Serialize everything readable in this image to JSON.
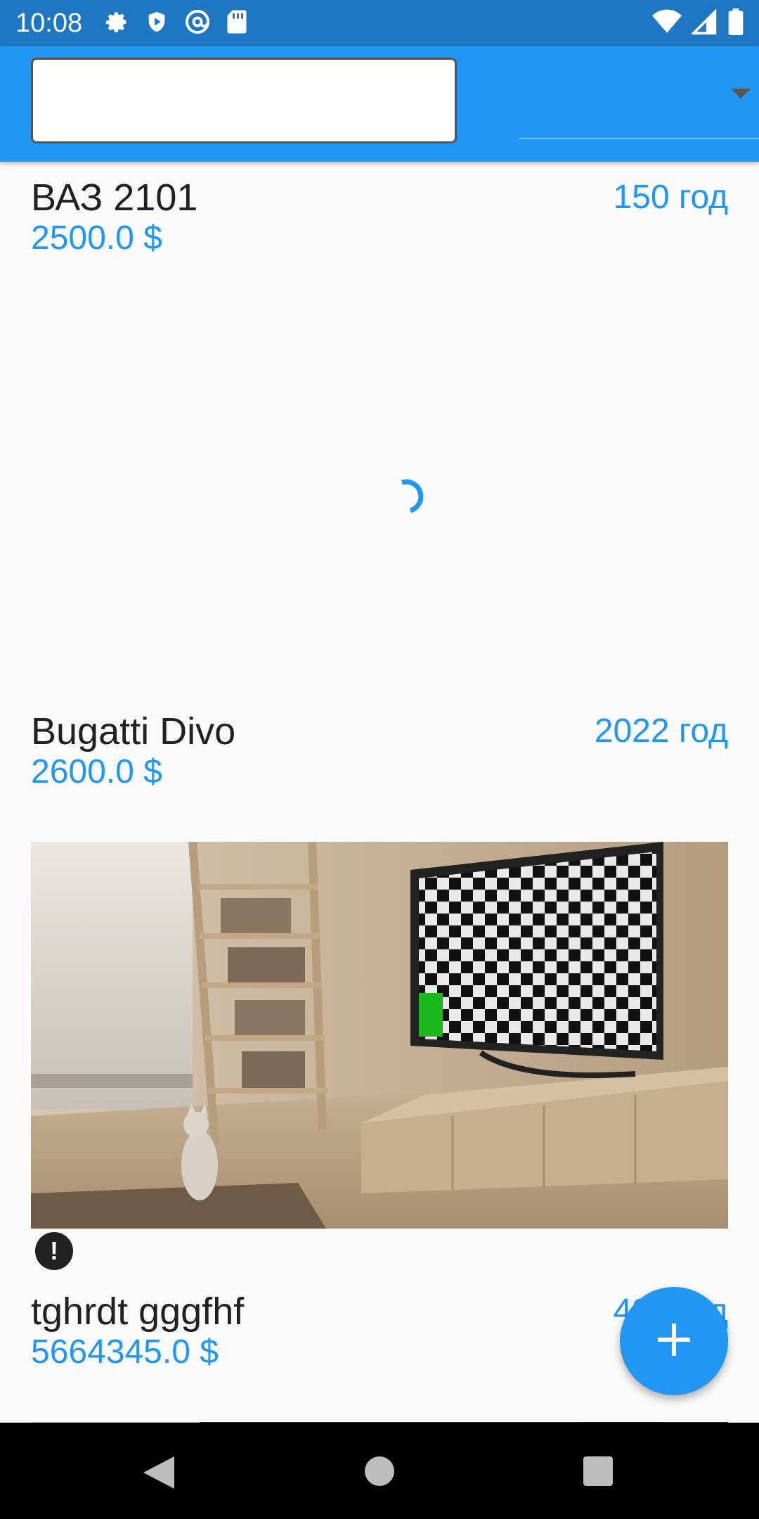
{
  "status_bar": {
    "time": "10:08",
    "left_icons": [
      "settings-icon",
      "shield-icon",
      "at-sign-icon",
      "sd-card-icon"
    ],
    "right_icons": [
      "wifi-icon",
      "signal-icon",
      "battery-icon"
    ]
  },
  "app_bar": {
    "search_value": "",
    "dropdown_value": ""
  },
  "items": [
    {
      "title": "ВАЗ 2101",
      "year": "150 год",
      "price": "2500.0 $",
      "image": "loading"
    },
    {
      "title": "Bugatti Divo",
      "year": "2022 год",
      "price": "2600.0 $",
      "image": "room-with-tv-photo",
      "error": true
    },
    {
      "title": "tghrdt gggfhf",
      "year": "422 год",
      "price": "5664345.0 $",
      "image": "room-photo"
    }
  ],
  "fab": {
    "icon": "plus-icon"
  },
  "colors": {
    "accent": "#2196f3",
    "status_bar": "#1f76c2",
    "text": "#212121"
  },
  "nav_bar": {
    "icons": [
      "back-icon",
      "home-icon",
      "recents-icon"
    ]
  }
}
